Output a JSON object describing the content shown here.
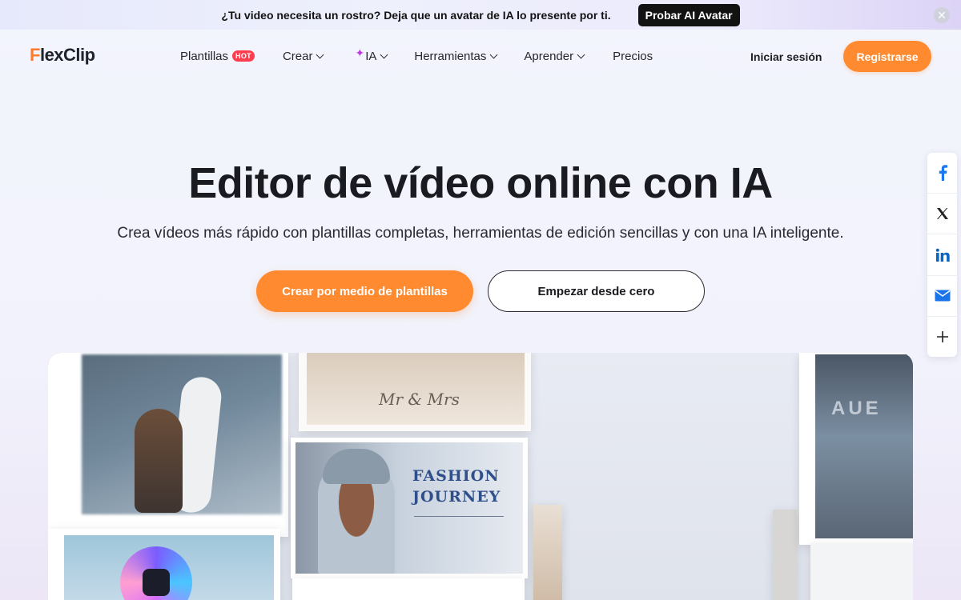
{
  "banner": {
    "text": "¿Tu video necesita un rostro? Deja que un avatar de IA lo presente por ti.",
    "button_label": "Probar AI Avatar",
    "close_glyph": "✕"
  },
  "nav": {
    "logo_f": "F",
    "logo_rest": "lexClip",
    "items": [
      {
        "label": "Plantillas",
        "badge": "HOT"
      },
      {
        "label": "Crear"
      },
      {
        "label": "IA",
        "prefix_icon": "sparkle-icon",
        "prefix_glyph": "✦"
      },
      {
        "label": "Herramientas"
      },
      {
        "label": "Aprender"
      },
      {
        "label": "Precios"
      }
    ],
    "login_label": "Iniciar sesión",
    "signup_label": "Registrarse"
  },
  "hero": {
    "title": "Editor de vídeo online con IA",
    "subtitle": "Crea vídeos más rápido con plantillas completas, herramientas de edición sencillas y con una IA inteligente.",
    "primary_button": "Crear por medio de plantillas",
    "secondary_button": "Empezar desde cero"
  },
  "showcase": {
    "fashion_line1": "FASHION",
    "fashion_line2": "JOURNEY",
    "wedding_script": "Mr & Mrs",
    "right_tile_text": "AUE"
  },
  "share": {
    "items": [
      "facebook-icon",
      "x-icon",
      "linkedin-icon",
      "mail-icon",
      "plus-icon"
    ]
  },
  "colors": {
    "accent": "#ff8a2f",
    "hot_badge": "#ff3d4f",
    "facebook": "#1877f2",
    "linkedin": "#0a66c2",
    "mail": "#1a73e8"
  }
}
